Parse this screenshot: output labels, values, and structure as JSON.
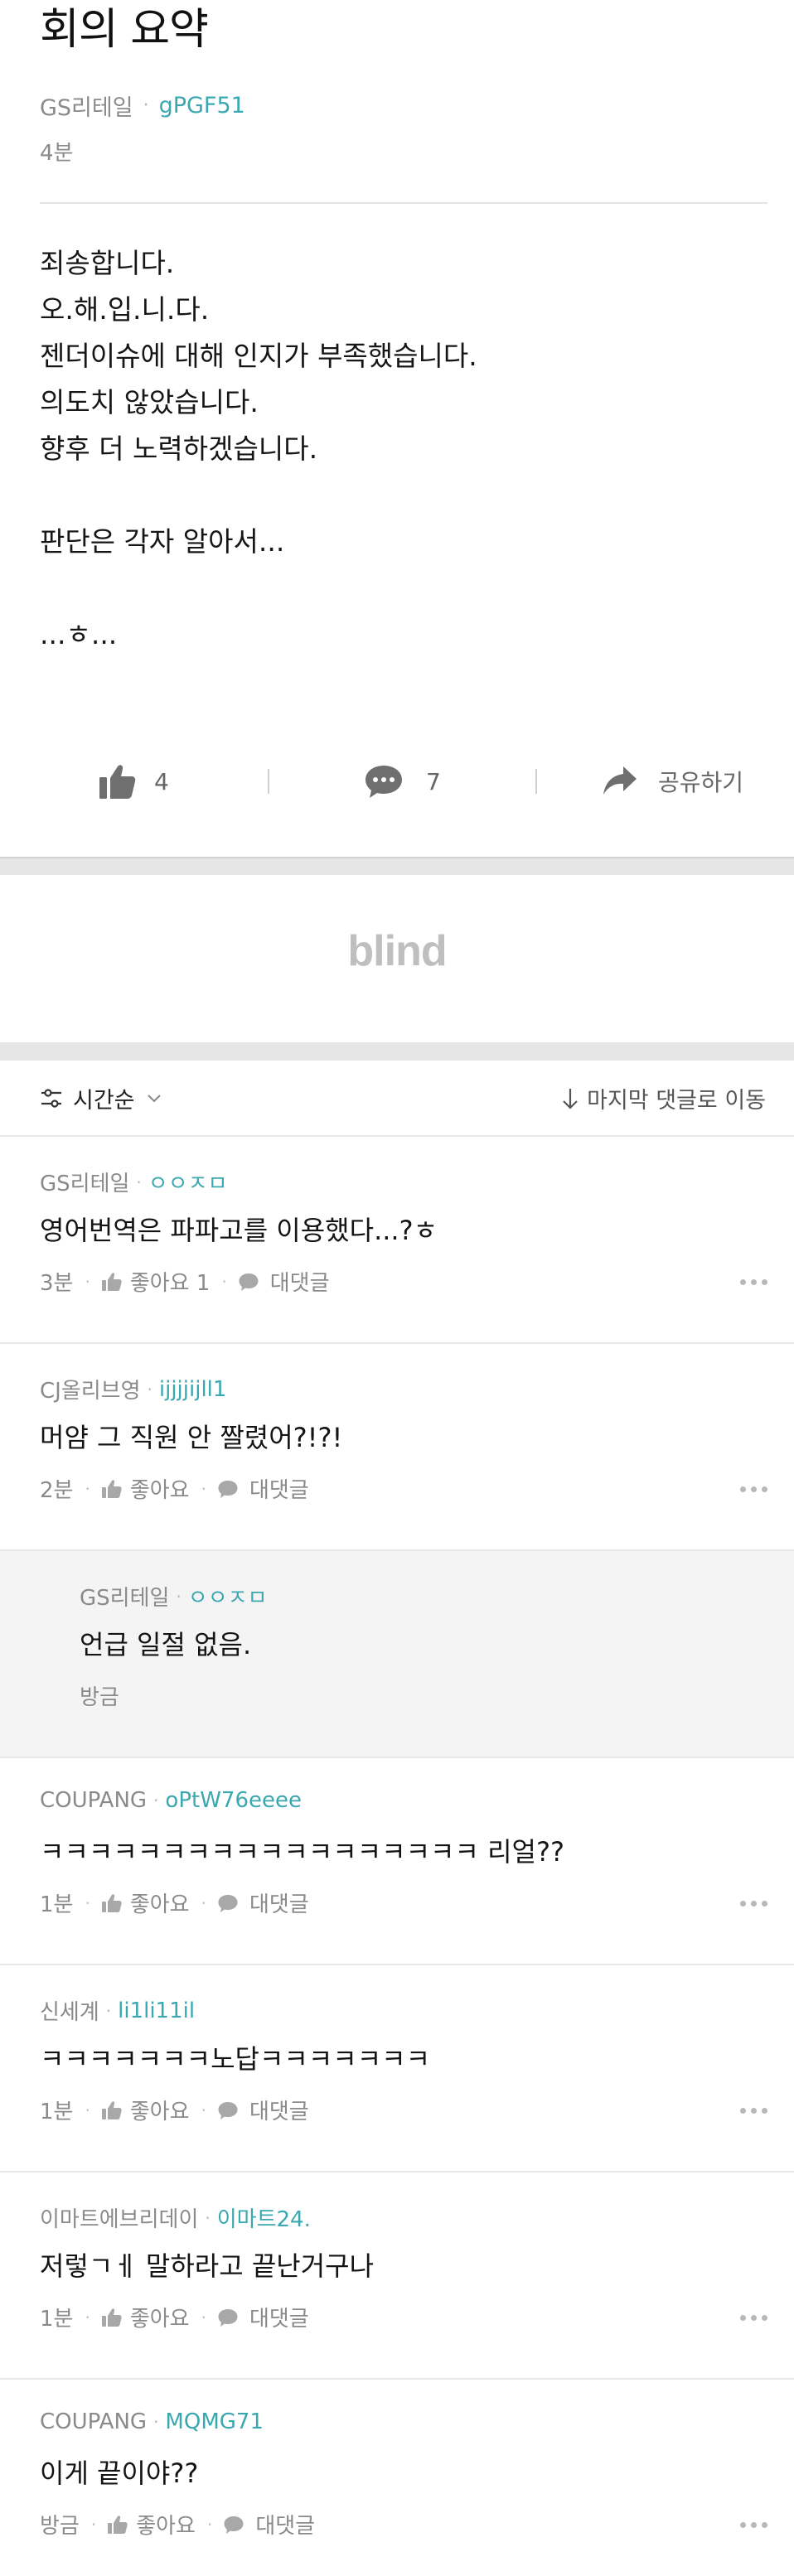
{
  "post": {
    "title": "회의 요약",
    "company": "GS리테일",
    "nickname": "gPGF51",
    "time": "4분",
    "body_lines": [
      "죄송합니다.",
      "오.해.입.니.다.",
      "젠더이슈에 대해 인지가 부족했습니다.",
      "의도치 않았습니다.",
      "향후 더 노력하겠습니다.",
      "",
      "판단은 각자 알아서...",
      "",
      "...ㅎ..."
    ]
  },
  "actions": {
    "like_count": "4",
    "comment_count": "7",
    "share_label": "공유하기"
  },
  "ad": {
    "logo": "blind"
  },
  "sort": {
    "label": "시간순",
    "jump_label": "마지막 댓글로 이동"
  },
  "comments": [
    {
      "company": "GS리테일",
      "nickname": "ㅇㅇㅈㅁ",
      "text": "영어번역은 파파고를 이용했다...?ㅎ",
      "time": "3분",
      "like_label": "좋아요 1",
      "reply_label": "대댓글",
      "is_reply": false
    },
    {
      "company": "CJ올리브영",
      "nickname": "ijjjjijll1",
      "text": "머얌 그 직원 안 짤렸어?!?!",
      "time": "2분",
      "like_label": "좋아요",
      "reply_label": "대댓글",
      "is_reply": false
    },
    {
      "company": "GS리테일",
      "nickname": "ㅇㅇㅈㅁ",
      "text": "언급 일절 없음.",
      "time": "방금",
      "is_reply": true
    },
    {
      "company": "COUPANG",
      "nickname": "oPtW76eeee",
      "text": "ㅋㅋㅋㅋㅋㅋㅋㅋㅋㅋㅋㅋㅋㅋㅋㅋㅋㅋ 리얼??",
      "time": "1분",
      "like_label": "좋아요",
      "reply_label": "대댓글",
      "is_reply": false
    },
    {
      "company": "신세계",
      "nickname": "li1li11il",
      "text": "ㅋㅋㅋㅋㅋㅋㅋ노답ㅋㅋㅋㅋㅋㅋㅋ",
      "time": "1분",
      "like_label": "좋아요",
      "reply_label": "대댓글",
      "is_reply": false
    },
    {
      "company": "이마트에브리데이",
      "nickname": "이마트24.",
      "text": "저렇ㄱㅔ 말하라고 끝난거구나",
      "time": "1분",
      "like_label": "좋아요",
      "reply_label": "대댓글",
      "is_reply": false
    },
    {
      "company": "COUPANG",
      "nickname": "MQMG71",
      "text": "이게 끝이야??",
      "time": "방금",
      "like_label": "좋아요",
      "reply_label": "대댓글",
      "is_reply": false
    }
  ],
  "colors": {
    "nickname": "#3aa8b0",
    "meta": "#8a8a8a",
    "reply_bg": "#f4f4f4",
    "separator_band": "#e6e6e6"
  }
}
